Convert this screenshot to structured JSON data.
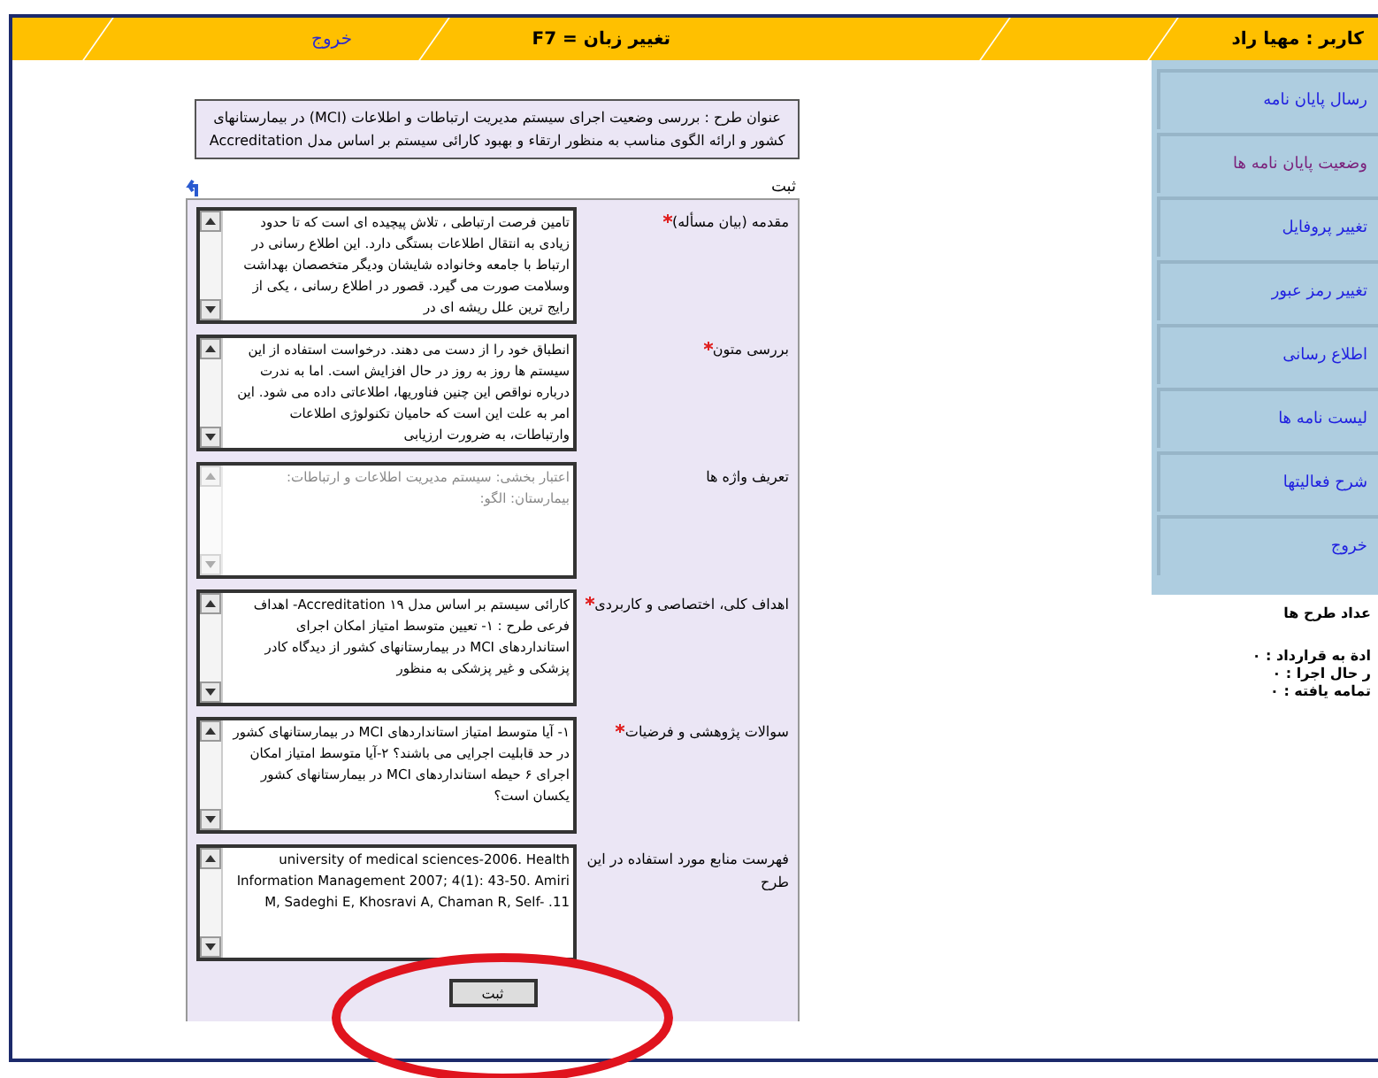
{
  "top_bar": {
    "user": "کاربر : مهیا راد",
    "language_hint": "F7 = تغییر زبان",
    "logout": "خروج"
  },
  "title_box": "عنوان طرح : بررسی وضعیت اجرای سیستم مدیریت ارتباطات و اطلاعات (MCI) در بیمارستانهای کشور و ارائه الگوی مناسب به منظور ارتقاء و بهبود کارائی سیستم بر اساس مدل Accreditation",
  "form_caption": "ثبت",
  "fields": [
    {
      "label": "مقدمه (بیان مسأله)",
      "required": true,
      "disabled": false,
      "value": "تامین فرصت ارتباطی ، تلاش پیچیده ای است که تا حدود زیادی به انتقال اطلاعات بستگی دارد. این اطلاع رسانی در ارتباط با جامعه وخانواده شایشان ودیگر متخصصان بهداشت وسلامت صورت می گیرد. قصور در اطلاع رسانی ، یکی از رایج ترین علل ریشه ای در"
    },
    {
      "label": "بررسی متون",
      "required": true,
      "disabled": false,
      "value": "انطباق خود را از دست می دهند. درخواست استفاده از این سیستم ها روز به روز در حال افزایش است. اما به ندرت درباره نواقص این چنین فناوریها، اطلاعاتی داده می شود. این امر به علت این است که حامیان تکنولوژی اطلاعات وارتباطات، به ضرورت ارزیابی"
    },
    {
      "label": "تعریف واژه ها",
      "required": false,
      "disabled": true,
      "value": "اعتبار بخشی: سیستم مدیریت اطلاعات و ارتباطات: بیمارستان: الگو:"
    },
    {
      "label": "اهداف کلی، اختصاصی و کاربردی",
      "required": true,
      "disabled": false,
      "value": "کارائی سیستم بر اساس مدل Accreditation ۱۹- اهداف فرعی طرح : ۱- تعیین متوسط امتیاز امکان اجرای استانداردهای MCI در بیمارستانهای کشور از دیدگاه کادر پزشکی و غیر پزشکی به منظور"
    },
    {
      "label": "سوالات پژوهشی و فرضیات",
      "required": true,
      "disabled": false,
      "value": "۱- آیا متوسط امتیاز استانداردهای MCI در بیمارستانهای کشور در حد قابلیت اجرایی می باشند؟ ۲-آیا متوسط امتیاز امکان اجرای ۶ حیطه استانداردهای MCI در بیمارستانهای کشور یکسان است؟"
    },
    {
      "label": "فهرست منابع مورد استفاده در این طرح",
      "required": false,
      "disabled": false,
      "value": "university of medical sciences-2006. Health Information Management 2007; 4(1): 43-50. Amiri M, Sadeghi E, Khosravi A, Chaman R, Self- .11"
    }
  ],
  "submit": "ثبت",
  "sidebar": {
    "items": [
      {
        "label": "رسال پایان نامه",
        "visited": false
      },
      {
        "label": "وضعیت پایان نامه ها",
        "visited": true
      },
      {
        "label": "تغییر پروفایل",
        "visited": false
      },
      {
        "label": "تغییر رمز عبور",
        "visited": false
      },
      {
        "label": "اطلاع رسانی",
        "visited": false
      },
      {
        "label": "لیست نامه ها",
        "visited": false
      },
      {
        "label": "شرح فعالیتها",
        "visited": false
      },
      {
        "label": "خروج",
        "visited": false
      }
    ],
    "stats_title": "عداد طرح ها",
    "stats": [
      "ادة به قرارداد : ۰",
      "ر حال اجرا : ۰",
      "تمامه یافته : ۰"
    ]
  }
}
